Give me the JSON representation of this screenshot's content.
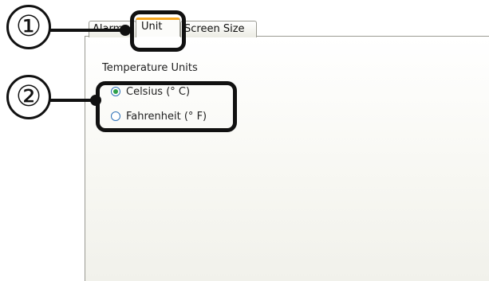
{
  "tabs": [
    {
      "label": "Alarm"
    },
    {
      "label": "Unit"
    },
    {
      "label": "Screen Size"
    }
  ],
  "group": {
    "label": "Temperature Units",
    "options": [
      {
        "label": "Celsius (° C)",
        "checked": true
      },
      {
        "label": "Fahrenheit (° F)",
        "checked": false
      }
    ]
  },
  "callouts": [
    "①",
    "②"
  ]
}
